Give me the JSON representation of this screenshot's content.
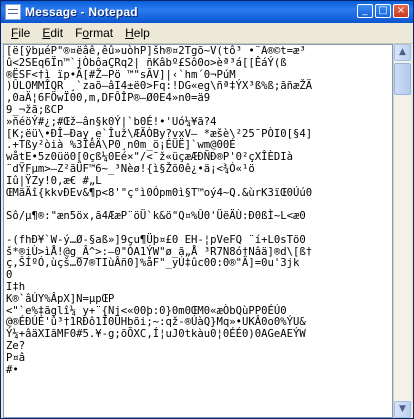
{
  "window": {
    "title": "Message - Notepad",
    "controls": {
      "minimize": "_",
      "maximize": "□",
      "close": "×"
    }
  },
  "menubar": {
    "items": [
      {
        "label": "File",
        "underline": "F",
        "rest": "ile"
      },
      {
        "label": "Edit",
        "underline": "E",
        "rest": "dit"
      },
      {
        "label": "Format",
        "underline": "o",
        "pre": "F",
        "rest": "rmat"
      },
      {
        "label": "Help",
        "underline": "H",
        "rest": "elp"
      }
    ]
  },
  "editor": {
    "content": "[ë[ÿbµéP\"®¤ëâê,êû»uòhP]šh®¤2Tgõ~V(tô³ •¨Ä®©t=æ³\nû<2SEq6Ïn™`jÒbôaÇRq2| ñKâbº£Sô0o>èª³á[[ÊáÝ(ß\n®ËSF<†ì ïp•Ä[#Ž—Pö ™\"sÃV]|‹`hm´0¬PúM\n)ÛLOMMÎQR ¸`zaõ—âI4±ë0>Fq:!DG«eg\\ñª‡ÝX³ß%ß;ãñæŽÄ\n,0aÄ¦6FÖwÏ00,m,DFÔÎP®—Ø0E4»n0=ä9\n9_¬žã;ßCP\n»ñéöÝ#¿;#Œž—ân§k0Ý|`b0É!•'Uó¼¥ã?4\n[K;ëü\\•ÐÎ—Ðay¸e`Îuž\\ÆÄÒBy?vxV— *æšè\\²25¯PÒI0[§4]\n.+Tßy²òià %3ÎêÄ\\P0¸n0m_ö¡ÉÜË]`wm@00É\nwåtE•5z0üö0[0çß¼0Eé×\"/<¯ž«üçæÆÐÑÐ®P'0²çXÎÈDIà\n¨dŸFµm>—Z²ãÜF™6~_³Nèø!{ì§Žõ0ê¿•ä¡<¾Ó«¹ö\nIû|ŸZy!0,æ€ #„L\nŒMãÄî{kkvÐEv&¶p<8'\"ç°ì0Ópm0ì§T™oý4~Q.&ùrK3ïŒ0Úú0\n\nSô/µ¶®:\"æn5öx,ã4ÆæP¨öÜ`k&ö\"Q¤%Û0'ÜëÄÙ:Ð0ßÌ~L<æ0\n\n-(fhÐ¥`W-ý…Ø-§aß»]9çu¶Üþ¤£0 EH-¦pVeFQ ¨í+L0sTö0\nš*®iÙ>ìÅ!@g_Â^>:—0\"ÒA1ÝW\"ø_ã„Å ³R7N8ó†Nâä]®d\\[ß†\nç,ŠÍºÓ,ùçš…07®TIùÂñ0]%åF\"_yÚ‡ûc00:0®\"Ä]=0u'3jk\n0\nI‡h\nK®`âÚY%ÂpX]N=µpŒP\n<\"`e%‡ãglî¼ y+¨{Nj<«00þ:0}0m0ŒM0«æÒbQùPP0ÉÚ0\n@®ÉÐÚÉ'û³†1RÐô1Î0ÜHbõi;~:qž-®ÚàQ}Mq»•UKÂ0o0%ÝU&\nÝ¼+âäXIãMF0#5.¥-g;õÕXC,Í¦uJ0tkàu0¦0ÉÉ0)0AGeAEÝW\nZe?\nP¤â\n#•"
  }
}
